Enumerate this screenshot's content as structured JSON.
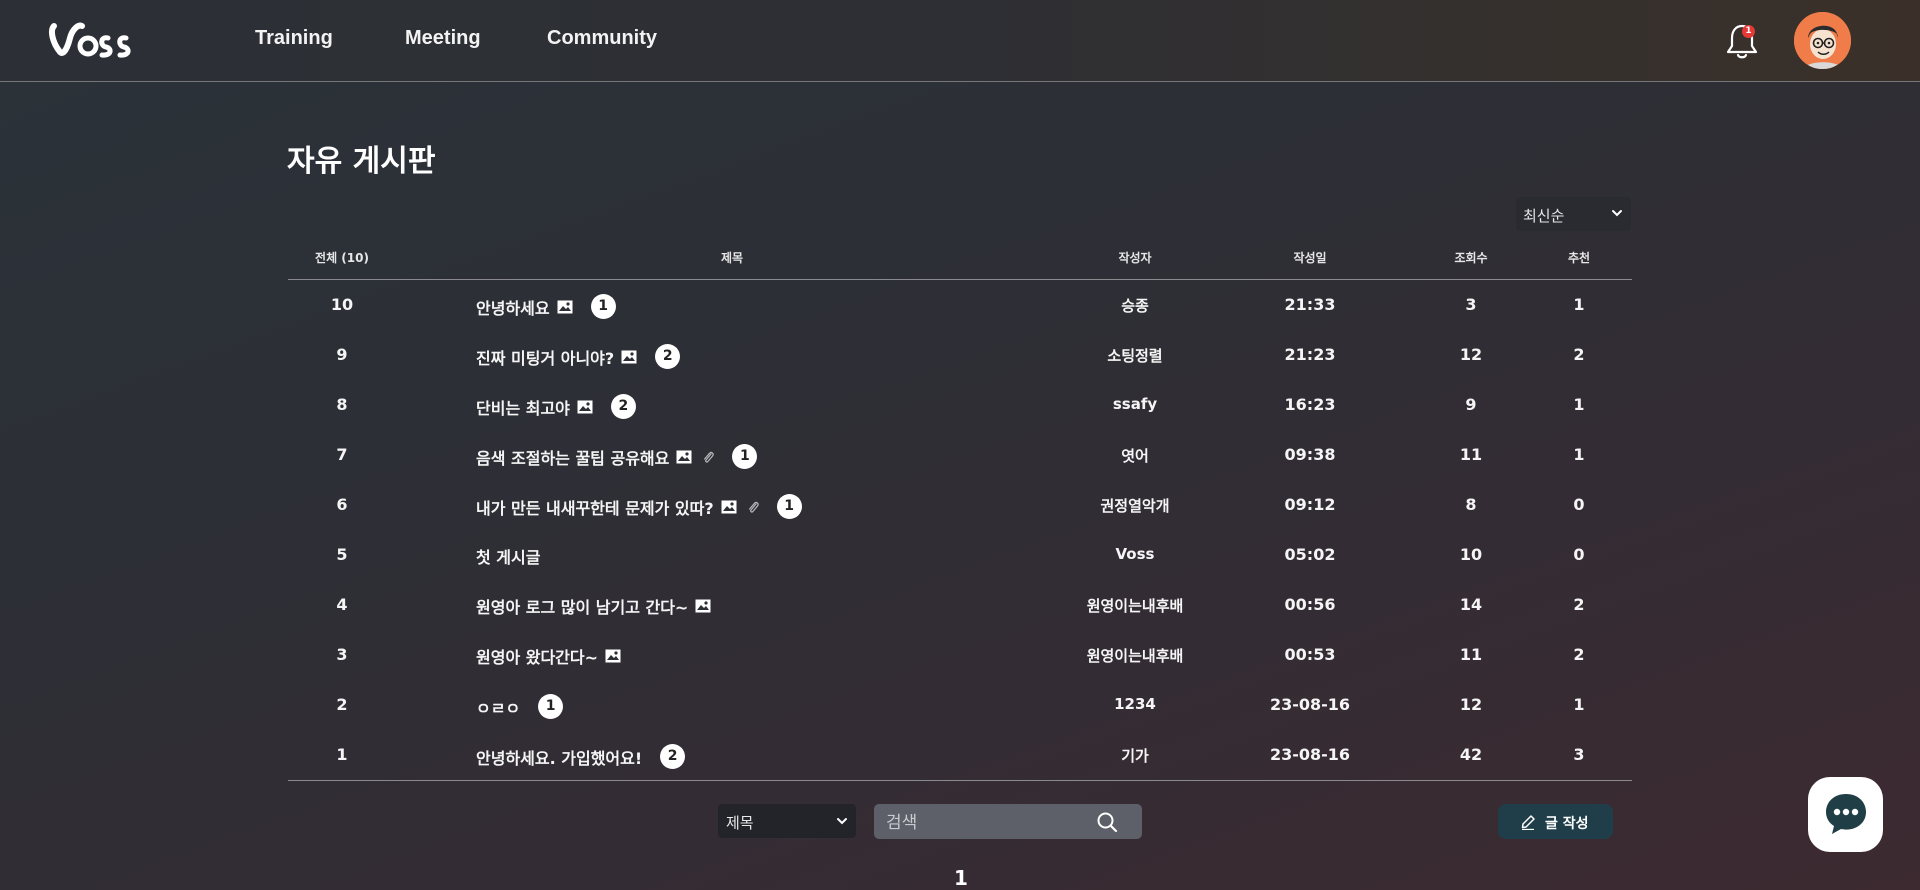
{
  "header": {
    "logo_text": "Voss",
    "nav": [
      "Training",
      "Meeting",
      "Community"
    ],
    "notification_count": "1"
  },
  "page": {
    "title": "자유 게시판",
    "sort": "최신순"
  },
  "table": {
    "headers": {
      "total": "전체 (10)",
      "title": "제목",
      "author": "작성자",
      "date": "작성일",
      "views": "조회수",
      "likes": "추천"
    },
    "rows": [
      {
        "no": "10",
        "title": "안녕하세요",
        "image": true,
        "attach": false,
        "comments": "1",
        "author": "승종",
        "date": "21:33",
        "views": "3",
        "likes": "1"
      },
      {
        "no": "9",
        "title": "진짜 미팅거 아니야?",
        "image": true,
        "attach": false,
        "comments": "2",
        "author": "소팅정렬",
        "date": "21:23",
        "views": "12",
        "likes": "2"
      },
      {
        "no": "8",
        "title": "단비는 최고야",
        "image": true,
        "attach": false,
        "comments": "2",
        "author": "ssafy",
        "date": "16:23",
        "views": "9",
        "likes": "1"
      },
      {
        "no": "7",
        "title": "음색 조절하는 꿀팁 공유해요",
        "image": true,
        "attach": true,
        "comments": "1",
        "author": "엿어",
        "date": "09:38",
        "views": "11",
        "likes": "1"
      },
      {
        "no": "6",
        "title": "내가 만든 내새꾸한테 문제가 있따?",
        "image": true,
        "attach": true,
        "comments": "1",
        "author": "권정열악개",
        "date": "09:12",
        "views": "8",
        "likes": "0"
      },
      {
        "no": "5",
        "title": "첫 게시글",
        "image": false,
        "attach": false,
        "comments": "",
        "author": "Voss",
        "date": "05:02",
        "views": "10",
        "likes": "0"
      },
      {
        "no": "4",
        "title": "원영아 로그 많이 남기고 간다~",
        "image": true,
        "attach": false,
        "comments": "",
        "author": "원영이는내후배",
        "date": "00:56",
        "views": "14",
        "likes": "2"
      },
      {
        "no": "3",
        "title": "원영아 왔다간다~",
        "image": true,
        "attach": false,
        "comments": "",
        "author": "원영이는내후배",
        "date": "00:53",
        "views": "11",
        "likes": "2"
      },
      {
        "no": "2",
        "title": "ㅇㄹㅇ",
        "image": false,
        "attach": false,
        "comments": "1",
        "author": "1234",
        "date": "23-08-16",
        "views": "12",
        "likes": "1"
      },
      {
        "no": "1",
        "title": "안녕하세요. 가입했어요!",
        "image": false,
        "attach": false,
        "comments": "2",
        "author": "기가",
        "date": "23-08-16",
        "views": "42",
        "likes": "3"
      }
    ]
  },
  "search": {
    "type": "제목",
    "placeholder": "검색"
  },
  "write_button": "글 작성",
  "pagination": {
    "current": "1"
  },
  "icons": {
    "bell": "bell-icon",
    "search": "search-icon",
    "image": "image-icon",
    "attachment": "paperclip-icon",
    "pencil": "pencil-icon",
    "chat": "chat-icon"
  },
  "colors": {
    "write_button": "#1f3e49",
    "badge": "#e53935",
    "avatar_bg": "#f07c4a"
  }
}
